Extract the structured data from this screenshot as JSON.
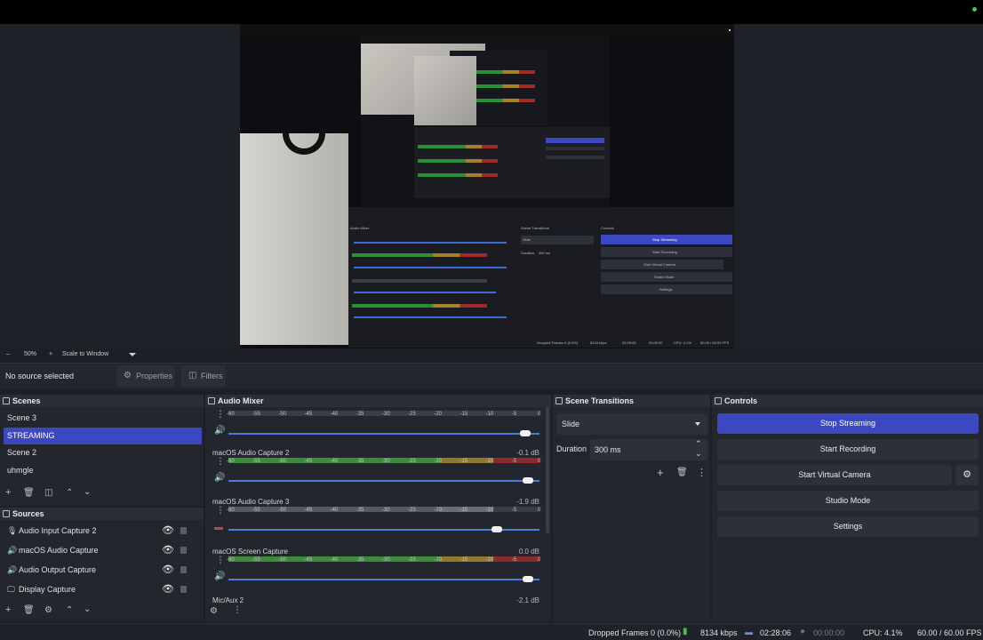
{
  "zoom": {
    "minus": "–",
    "level": "50%",
    "plus": "+",
    "mode": "Scale to Window"
  },
  "source_toolbar": {
    "status": "No source selected",
    "properties": "Properties",
    "filters": "Filters"
  },
  "scenes": {
    "title": "Scenes",
    "items": [
      {
        "label": "Scene 3",
        "selected": false
      },
      {
        "label": "STREAMING",
        "selected": true
      },
      {
        "label": "Scene 2",
        "selected": false
      },
      {
        "label": "uhmgle",
        "selected": false
      }
    ]
  },
  "sources": {
    "title": "Sources",
    "items": [
      {
        "label": "Audio Input Capture 2",
        "icon": "microphone-icon"
      },
      {
        "label": "macOS Audio Capture",
        "icon": "speaker-icon"
      },
      {
        "label": "Audio Output Capture",
        "icon": "speaker-icon"
      },
      {
        "label": "Display Capture",
        "icon": "monitor-icon"
      }
    ]
  },
  "audio_mixer": {
    "title": "Audio Mixer",
    "ticks": [
      "-60",
      "-55",
      "-50",
      "-45",
      "-40",
      "-35",
      "-30",
      "-25",
      "-20",
      "-15",
      "-10",
      "-5",
      "0"
    ],
    "channels": [
      {
        "name": "",
        "db": "",
        "level": 0,
        "volume": 0.97
      },
      {
        "name": "macOS Audio Capture 2",
        "db": "-0.1 dB",
        "level": 1.0,
        "volume": 0.98
      },
      {
        "name": "macOS Audio Capture 3",
        "db": "-1.9 dB",
        "level": 0.85,
        "volume": 0.88
      },
      {
        "name": "macOS Screen Capture",
        "db": "0.0 dB",
        "level": 1.0,
        "volume": 0.98
      },
      {
        "name": "Mic/Aux 2",
        "db": "-2.1 dB",
        "level": 0,
        "volume": 0
      }
    ]
  },
  "scene_transitions": {
    "title": "Scene Transitions",
    "transition": "Slide",
    "duration_label": "Duration",
    "duration_value": "300 ms"
  },
  "controls": {
    "title": "Controls",
    "stop_streaming": "Stop Streaming",
    "start_recording": "Start Recording",
    "start_virtual_camera": "Start Virtual Camera",
    "studio_mode": "Studio Mode",
    "settings": "Settings"
  },
  "status": {
    "dropped_frames": "Dropped Frames 0 (0.0%)",
    "bitrate": "8134 kbps",
    "stream_time": "02:28:06",
    "record_time": "00:00:00",
    "cpu": "CPU: 4.1%",
    "fps": "60.00 / 60.00 FPS"
  },
  "mini_preview": {
    "audio_mixer": "Audio Mixer",
    "scene_transitions": "Scene Transitions",
    "controls": "Controls",
    "slide": "Slide",
    "duration": "Duration",
    "duration_value": "300 ms",
    "stop_streaming": "Stop Streaming",
    "start_recording": "Start Recording",
    "start_virtual_camera": "Start Virtual Camera",
    "studio_mode": "Studio Mode",
    "settings": "Settings",
    "dropped": "Dropped Frames 0 (0.0%)",
    "kbps": "8134 kbps",
    "time": "02:28:06",
    "rec": "00:00:00",
    "cpu": "CPU: 4.1%",
    "fps": "60.00 / 60.00 FPS"
  },
  "colors": {
    "accent": "#3c48bf",
    "panel": "#24262e",
    "meter_green": "#3d8a3b",
    "meter_yellow": "#8f7a2c",
    "meter_red": "#8a2a2a"
  }
}
